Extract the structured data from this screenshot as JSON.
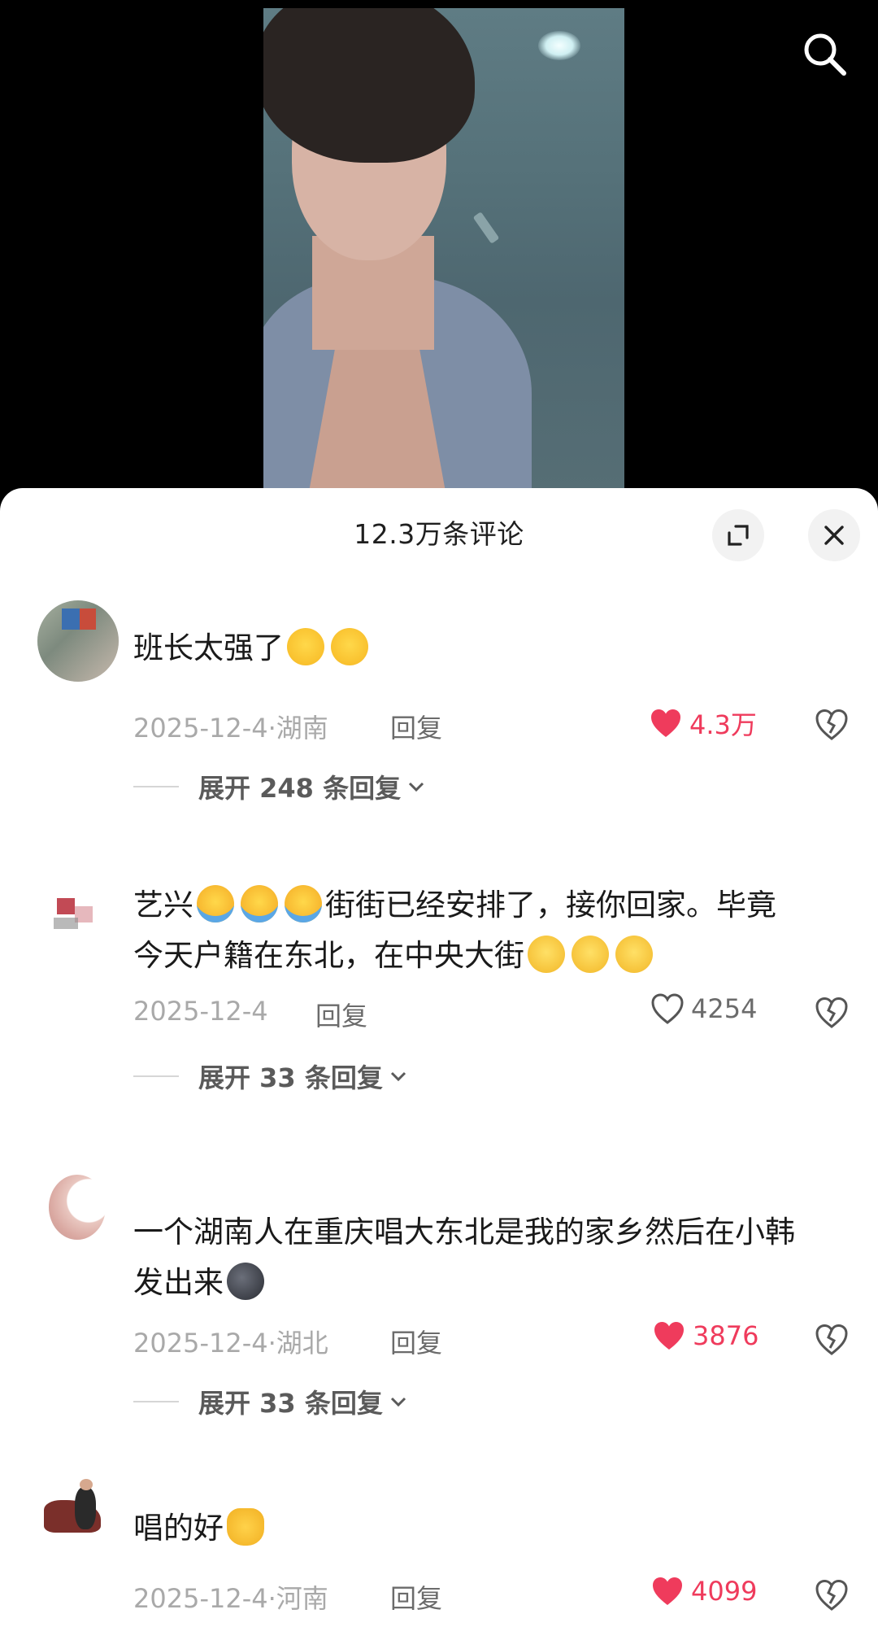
{
  "sheet": {
    "title": "12.3万条评论"
  },
  "comments": [
    {
      "text": "班长太强了",
      "emojis": [
        "crying-face",
        "crying-face"
      ],
      "date": "2025-12-4",
      "location": "湖南",
      "reply_label": "回复",
      "likes": "4.3万",
      "liked": true,
      "expand_text": "展开 248 条回复"
    },
    {
      "text_line1": "艺兴",
      "text_line1b": "街街已经安排了，接你回家。毕竟",
      "text_line2": "今天户籍在东北，在中央大街",
      "emojis_a": [
        "hug-face",
        "hug-face",
        "hug-face"
      ],
      "emojis_b": [
        "pleading-face",
        "pleading-face",
        "pleading-face"
      ],
      "date": "2025-12-4",
      "location": "",
      "reply_label": "回复",
      "likes": "4254",
      "liked": false,
      "expand_text": "展开 33 条回复"
    },
    {
      "text_line1": "一个湖南人在重庆唱大东北是我的家乡然后在小韩",
      "text_line2": "发出来",
      "emojis": [
        "new-moon-face"
      ],
      "date": "2025-12-4",
      "location": "湖北",
      "reply_label": "回复",
      "likes": "3876",
      "liked": true,
      "expand_text": "展开 33 条回复"
    },
    {
      "text": "唱的好",
      "emojis": [
        "heart-hands"
      ],
      "date": "2025-12-4",
      "location": "河南",
      "reply_label": "回复",
      "likes": "4099",
      "liked": true
    }
  ],
  "icons": {
    "search": "search-icon",
    "expand": "expand-icon",
    "close": "close-icon",
    "like": "heart-icon",
    "dislike": "broken-heart-icon",
    "chevron": "chevron-down-icon"
  },
  "colors": {
    "like_active": "#ef3b5c",
    "meta_text": "#a9a9a9",
    "background_top": "#000000",
    "sheet_background": "#ffffff"
  }
}
